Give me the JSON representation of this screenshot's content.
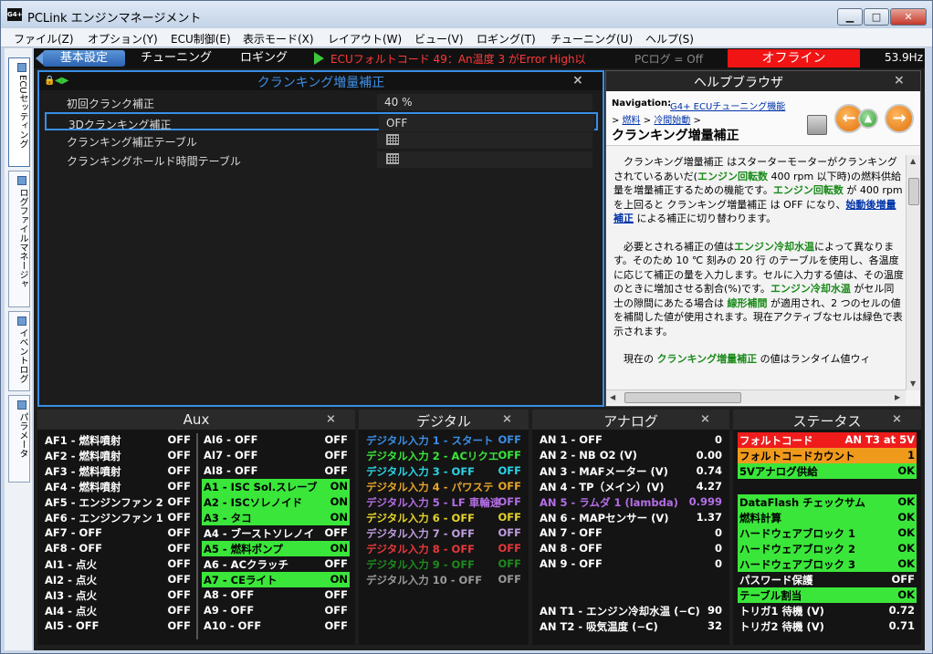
{
  "window": {
    "title": "PCLink エンジンマネージメント",
    "app_icon": "G4+"
  },
  "menu": [
    "ファイル(Z)",
    "オプション(Y)",
    "ECU制御(E)",
    "表示モード(X)",
    "レイアウト(W)",
    "ビュー(V)",
    "ロギング(T)",
    "チューニング(U)",
    "ヘルプ(S)"
  ],
  "toolbar": {
    "tabs": [
      "基本設定",
      "チューニング",
      "ロギング"
    ],
    "fault_text": "ECUフォルトコード 49：An温度 3 がError High以",
    "pclog": "PCログ = Off",
    "offline": "オフライン",
    "frequency": "53.9Hz"
  },
  "side_tabs": [
    "ECUセッティング",
    "ログファイルマネージャ",
    "イベントログ",
    "パラメータ"
  ],
  "cranking": {
    "title": "クランキング増量補正",
    "rows": [
      {
        "label": "初回クランク補正",
        "value": "40 %"
      },
      {
        "label": "3Dクランキング補正",
        "value": "OFF"
      },
      {
        "label": "クランキング補正テーブル",
        "value": ""
      },
      {
        "label": "クランキングホールド時間テーブル",
        "value": ""
      }
    ]
  },
  "help": {
    "title": "ヘルプブラウザ",
    "nav_label": "Navigation:",
    "nav_link": "G4+ ECUチューニング機能",
    "crumb_prefix": "> ",
    "crumb_1": "燃料",
    "crumb_sep": " > ",
    "crumb_2": "冷間始動",
    "crumb_suffix": " >",
    "heading": "クランキング増量補正",
    "p1": [
      {
        "t": "クランキング増量補正 はスターターモーターがクランキングされているあいだ("
      },
      {
        "t": "エンジン回転数",
        "k": "kw"
      },
      {
        "t": " 400 rpm 以下時)の燃料供給量を増量補正するための機能です。"
      },
      {
        "t": "エンジン回転数",
        "k": "kw"
      },
      {
        "t": " が 400 rpm を上回ると クランキング増量補正 は OFF になり、"
      },
      {
        "t": "始動後増量補正",
        "k": "lk"
      },
      {
        "t": " による補正に切り替わります。"
      }
    ],
    "p2": [
      {
        "t": "必要とされる補正の値は"
      },
      {
        "t": "エンジン冷却水温",
        "k": "kw"
      },
      {
        "t": "によって異なります。そのため 10 ℃ 刻みの 20 行 のテーブルを使用し、各温度に応じて補正の量を入力します。セルに入力する値は、その温度のときに増加させる割合(%)です。"
      },
      {
        "t": "エンジン冷却水温",
        "k": "kw"
      },
      {
        "t": " がセル同士の隙間にあたる場合は "
      },
      {
        "t": "線形補間",
        "k": "kw"
      },
      {
        "t": " が適用され、2 つのセルの値を補間した値が使用されます。現在アクティブなセルは緑色で表示されます。"
      }
    ],
    "p3": [
      {
        "t": "現在の "
      },
      {
        "t": "クランキング増量補正",
        "k": "kw"
      },
      {
        "t": " の値はランタイム値ウィ"
      }
    ]
  },
  "aux": {
    "title": "Aux",
    "left": [
      {
        "label": "AF1 - 燃料噴射",
        "value": "OFF",
        "on": false
      },
      {
        "label": "AF2 - 燃料噴射",
        "value": "OFF",
        "on": false
      },
      {
        "label": "AF3 - 燃料噴射",
        "value": "OFF",
        "on": false
      },
      {
        "label": "AF4 - 燃料噴射",
        "value": "OFF",
        "on": false
      },
      {
        "label": "AF5 - エンジンファン 2",
        "value": "OFF",
        "on": false
      },
      {
        "label": "AF6 - エンジンファン 1",
        "value": "OFF",
        "on": false
      },
      {
        "label": "AF7 - OFF",
        "value": "OFF",
        "on": false
      },
      {
        "label": "AF8 - OFF",
        "value": "OFF",
        "on": false
      },
      {
        "label": "AI1 - 点火",
        "value": "OFF",
        "on": false
      },
      {
        "label": "AI2 - 点火",
        "value": "OFF",
        "on": false
      },
      {
        "label": "AI3 - 点火",
        "value": "OFF",
        "on": false
      },
      {
        "label": "AI4 - 点火",
        "value": "OFF",
        "on": false
      },
      {
        "label": "AI5 - OFF",
        "value": "OFF",
        "on": false
      }
    ],
    "right": [
      {
        "label": "AI6 - OFF",
        "value": "OFF",
        "on": false
      },
      {
        "label": "AI7 - OFF",
        "value": "OFF",
        "on": false
      },
      {
        "label": "AI8 - OFF",
        "value": "OFF",
        "on": false
      },
      {
        "label": "A1 - ISC Sol.スレーブ",
        "value": "ON",
        "on": true
      },
      {
        "label": "A2 - ISCソレノイド",
        "value": "ON",
        "on": true
      },
      {
        "label": "A3 - タコ",
        "value": "ON",
        "on": true
      },
      {
        "label": "A4 - ブーストソレノイ",
        "value": "OFF",
        "on": false
      },
      {
        "label": "A5 - 燃料ポンプ",
        "value": "ON",
        "on": true
      },
      {
        "label": "A6 - ACクラッチ",
        "value": "OFF",
        "on": false
      },
      {
        "label": "A7 - CEライト",
        "value": "ON",
        "on": true
      },
      {
        "label": "A8 - OFF",
        "value": "OFF",
        "on": false
      },
      {
        "label": "A9 - OFF",
        "value": "OFF",
        "on": false
      },
      {
        "label": "A10 - OFF",
        "value": "OFF",
        "on": false
      }
    ]
  },
  "digital": {
    "title": "デジタル",
    "rows": [
      {
        "label": "デジタル入力 1 - スタート",
        "value": "OFF",
        "color": "#3a8ee6"
      },
      {
        "label": "デジタル入力 2 - ACリクエ",
        "value": "OFF",
        "color": "#3ae63a"
      },
      {
        "label": "デジタル入力 3 - OFF",
        "value": "OFF",
        "color": "#2ad4e6"
      },
      {
        "label": "デジタル入力 4 - パワステ",
        "value": "OFF",
        "color": "#e6a42a"
      },
      {
        "label": "デジタル入力 5 - LF 車輪速",
        "value": "OFF",
        "color": "#b46ee6"
      },
      {
        "label": "デジタル入力 6 - OFF",
        "value": "OFF",
        "color": "#e6d42a"
      },
      {
        "label": "デジタル入力 7 - OFF",
        "value": "OFF",
        "color": "#c09ee0"
      },
      {
        "label": "デジタル入力 8 - OFF",
        "value": "OFF",
        "color": "#e6383a"
      },
      {
        "label": "デジタル入力 9 - OFF",
        "value": "OFF",
        "color": "#1e8a1e"
      },
      {
        "label": "デジタル入力 10 - OFF",
        "value": "OFF",
        "color": "#9a9a9a"
      }
    ]
  },
  "analog": {
    "title": "アナログ",
    "rows": [
      {
        "label": "AN 1 - OFF",
        "value": "0",
        "color": "#ffffff"
      },
      {
        "label": "AN 2 - NB O2 (V)",
        "value": "0.00",
        "color": "#ffffff"
      },
      {
        "label": "AN 3 - MAFメーター (V)",
        "value": "0.74",
        "color": "#ffffff"
      },
      {
        "label": "AN 4 - TP（メイン）(V)",
        "value": "4.27",
        "color": "#ffffff"
      },
      {
        "label": "AN 5 - ラムダ 1 (lambda)",
        "value": "0.999",
        "color": "#b46ee6"
      },
      {
        "label": "AN 6 - MAPセンサー (V)",
        "value": "1.37",
        "color": "#ffffff"
      },
      {
        "label": "AN 7 - OFF",
        "value": "0",
        "color": "#ffffff"
      },
      {
        "label": "AN 8 - OFF",
        "value": "0",
        "color": "#ffffff"
      },
      {
        "label": "AN 9 - OFF",
        "value": "0",
        "color": "#ffffff"
      }
    ],
    "temps": [
      {
        "label": "AN T1 - エンジン冷却水温 (−C)",
        "value": "90"
      },
      {
        "label": "AN T2 - 吸気温度 (−C)",
        "value": "32"
      }
    ]
  },
  "status": {
    "title": "ステータス",
    "rows": [
      {
        "label": "フォルトコード",
        "value": "AN T3 at 5V",
        "style": "redbg"
      },
      {
        "label": "フォルトコードカウント",
        "value": "1",
        "style": "orbg"
      },
      {
        "label": "5Vアナログ供給",
        "value": "OK",
        "style": "on"
      },
      {
        "label": "",
        "value": "",
        "style": ""
      },
      {
        "label": "DataFlash チェックサム",
        "value": "OK",
        "style": "on"
      },
      {
        "label": "燃料計算",
        "value": "OK",
        "style": "on"
      },
      {
        "label": "ハードウェアブロック 1",
        "value": "OK",
        "style": "on"
      },
      {
        "label": "ハードウェアブロック 2",
        "value": "OK",
        "style": "on"
      },
      {
        "label": "ハードウェアブロック 3",
        "value": "OK",
        "style": "on"
      },
      {
        "label": "パスワード保護",
        "value": "OFF",
        "style": ""
      },
      {
        "label": "テーブル割当",
        "value": "OK",
        "style": "on"
      },
      {
        "label": "トリガ1 待機 (V)",
        "value": "0.72",
        "style": ""
      },
      {
        "label": "トリガ2 待機 (V)",
        "value": "0.71",
        "style": ""
      }
    ]
  }
}
